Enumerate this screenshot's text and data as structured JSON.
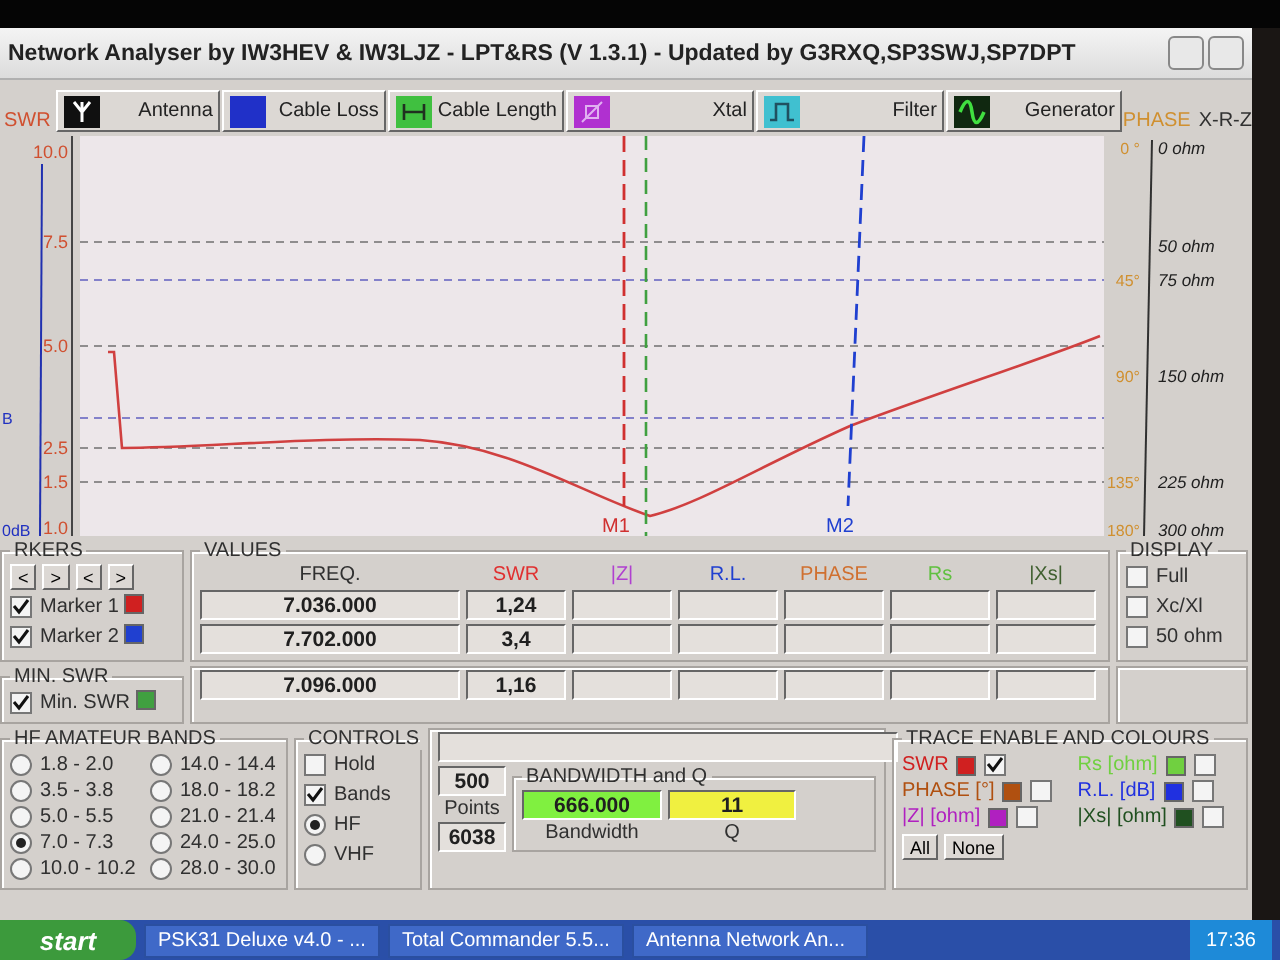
{
  "window": {
    "title": "Network Analyser by IW3HEV & IW3LJZ - LPT&RS (V 1.3.1) - Updated by G3RXQ,SP3SWJ,SP7DPT"
  },
  "modes": [
    {
      "kind": "antenna",
      "label": "Antenna",
      "color": "#101010"
    },
    {
      "kind": "cable_loss",
      "label": "Cable Loss",
      "color": "#2030c8"
    },
    {
      "kind": "cable_length",
      "label": "Cable Length",
      "color": "#40c040"
    },
    {
      "kind": "xtal",
      "label": "Xtal",
      "color": "#b030d0"
    },
    {
      "kind": "filter",
      "label": "Filter",
      "color": "#40c0d0"
    },
    {
      "kind": "generator",
      "label": "Generator",
      "color": "#102810"
    }
  ],
  "swr_axis": {
    "title": "SWR",
    "ticks": [
      "10.0",
      "7.5",
      "5.0",
      "2.5",
      "1.5",
      "1.0"
    ]
  },
  "db_axis": {
    "ticks": [
      "B",
      "0dB"
    ]
  },
  "phase_axis": {
    "title": "PHASE",
    "subtitle": "X-R-Z",
    "ticks": [
      {
        "phase": "0 °",
        "ohm": "0 ohm"
      },
      {
        "ohm": "50 ohm"
      },
      {
        "phase": "45°",
        "ohm": "75 ohm"
      },
      {
        "phase": "90°",
        "ohm": "150 ohm"
      },
      {
        "phase": "135°",
        "ohm": "225 ohm"
      },
      {
        "phase": "180°",
        "ohm": "300 ohm"
      }
    ]
  },
  "chart_markers": [
    {
      "label": "M1",
      "color": "#d03030"
    },
    {
      "label": "M2",
      "color": "#2040d0"
    }
  ],
  "markers": {
    "title": "RKERS",
    "nav_buttons": [
      "<",
      ">",
      "<",
      ">"
    ],
    "items": [
      {
        "label": "Marker 1",
        "checked": true,
        "color": "#d02020"
      },
      {
        "label": "Marker 2",
        "checked": true,
        "color": "#2040d0"
      }
    ]
  },
  "values": {
    "title": "VALUES",
    "columns": [
      {
        "label": "FREQ.",
        "color": "#303030"
      },
      {
        "label": "SWR",
        "color": "#e03030"
      },
      {
        "label": "|Z|",
        "color": "#b040d0"
      },
      {
        "label": "R.L.",
        "color": "#2040d0"
      },
      {
        "label": "PHASE",
        "color": "#d07030"
      },
      {
        "label": "Rs",
        "color": "#60c040"
      },
      {
        "label": "|Xs|",
        "color": "#406030"
      }
    ],
    "rows": [
      {
        "freq": "7.036.000",
        "swr": "1,24"
      },
      {
        "freq": "7.702.000",
        "swr": "3,4"
      }
    ]
  },
  "min_swr": {
    "title": "MIN. SWR",
    "label": "Min. SWR",
    "checked": true,
    "color": "#40a040",
    "freq": "7.096.000",
    "swr": "1,16"
  },
  "display": {
    "title": "DISPLAY",
    "options": [
      {
        "label": "Full",
        "checked": false
      },
      {
        "label": "Xc/Xl",
        "checked": false
      },
      {
        "label": "50 ohm",
        "checked": false
      }
    ]
  },
  "bands": {
    "title": "HF AMATEUR BANDS",
    "options": [
      {
        "label": "1.8 - 2.0",
        "selected": false
      },
      {
        "label": "3.5 - 3.8",
        "selected": false
      },
      {
        "label": "5.0 - 5.5",
        "selected": false
      },
      {
        "label": "7.0 - 7.3",
        "selected": true
      },
      {
        "label": "10.0 - 10.2",
        "selected": false
      },
      {
        "label": "14.0 - 14.4",
        "selected": false
      },
      {
        "label": "18.0 - 18.2",
        "selected": false
      },
      {
        "label": "21.0 - 21.4",
        "selected": false
      },
      {
        "label": "24.0 - 25.0",
        "selected": false
      },
      {
        "label": "28.0 - 30.0",
        "selected": false
      }
    ]
  },
  "controls": {
    "title": "CONTROLS",
    "options": [
      {
        "kind": "checkbox",
        "label": "Hold",
        "checked": false
      },
      {
        "kind": "checkbox",
        "label": "Bands",
        "checked": true
      },
      {
        "kind": "radio",
        "label": "HF",
        "checked": true
      },
      {
        "kind": "radio",
        "label": "VHF",
        "checked": false
      }
    ]
  },
  "points": {
    "value": "500",
    "label": "Points",
    "step": "6038"
  },
  "bandwidth": {
    "title": "BANDWIDTH and Q",
    "bandwidth": "666.000",
    "bandwidth_label": "Bandwidth",
    "q": "11",
    "q_label": "Q"
  },
  "traces": {
    "title": "TRACE ENABLE AND COLOURS",
    "items": [
      {
        "label": "SWR",
        "color": "#d02020",
        "checked": true
      },
      {
        "label": "PHASE [°]",
        "color": "#b05010",
        "checked": false
      },
      {
        "label": "|Z| [ohm]",
        "color": "#b020c0",
        "checked": false
      },
      {
        "label": "Rs [ohm]",
        "color": "#70d040",
        "checked": false
      },
      {
        "label": "R.L. [dB]",
        "color": "#2030e0",
        "checked": false
      },
      {
        "label": "|Xs| [ohm]",
        "color": "#205020",
        "checked": false
      }
    ],
    "buttons": [
      "All",
      "None"
    ]
  },
  "taskbar": {
    "start": "start",
    "tasks": [
      "PSK31 Deluxe v4.0 - ...",
      "Total Commander 5.5...",
      "Antenna Network An..."
    ],
    "clock": "17:36"
  }
}
